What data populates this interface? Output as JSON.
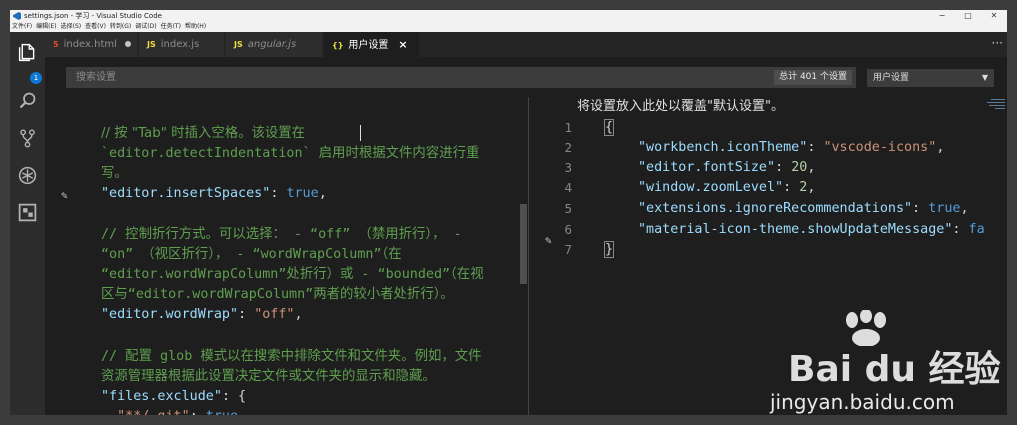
{
  "window": {
    "title": "settings.json - 学习 - Visual Studio Code",
    "controls": {
      "minimize": "−",
      "maximize": "□",
      "close": "✕"
    }
  },
  "menubar": [
    "文件(F)",
    "编辑(E)",
    "选择(S)",
    "查看(V)",
    "转到(G)",
    "调试(D)",
    "任务(T)",
    "帮助(H)"
  ],
  "activity_bar": {
    "icons": [
      "files-icon",
      "search-icon",
      "source-control-icon",
      "debug-icon",
      "extensions-icon"
    ],
    "badge": "1"
  },
  "tabs": [
    {
      "label": "index.html",
      "icon": "HTML5",
      "modified": true,
      "active": false
    },
    {
      "label": "index.js",
      "icon": "JS",
      "active": false
    },
    {
      "label": "angular.js",
      "icon": "JS",
      "active": false,
      "italic": true
    },
    {
      "label": "用户设置",
      "icon": "{}",
      "active": true,
      "close": "×"
    }
  ],
  "search": {
    "placeholder": "搜索设置",
    "count": "总计 401 个设置",
    "scope": "用户设置"
  },
  "left_editor": {
    "lines": [
      "// 按 \"Tab\" 时插入空格。该设置在",
      "`editor.detectIndentation` 启用时根据文件内容进行重",
      "写。",
      "\"editor.insertSpaces\": true,",
      "",
      "// 控制折行方式。可以选择： - “off” （禁用折行）， -",
      "“on” （视区折行）， - “wordWrapColumn”（在",
      "“editor.wordWrapColumn”处折行）或 - “bounded”（在视",
      "区与“editor.wordWrapColumn”两者的较小者处折行）。",
      "\"editor.wordWrap\": \"off\",",
      "",
      "// 配置 glob 模式以在搜索中排除文件和文件夹。例如，文件",
      "资源管理器根据此设置决定文件或文件夹的显示和隐藏。",
      "\"files.exclude\": {",
      "  \"**/.git\": true,"
    ]
  },
  "right_editor": {
    "header": "将设置放入此处以覆盖\"默认设置\"。",
    "line_numbers": [
      "1",
      "2",
      "3",
      "4",
      "5",
      "6",
      "7"
    ],
    "settings": [
      {
        "key": "\"workbench.iconTheme\"",
        "value": "\"vscode-icons\""
      },
      {
        "key": "\"editor.fontSize\"",
        "value": "20"
      },
      {
        "key": "\"window.zoomLevel\"",
        "value": "2"
      },
      {
        "key": "\"extensions.ignoreRecommendations\"",
        "value": "true"
      },
      {
        "key": "\"material-icon-theme.showUpdateMessage\"",
        "value": "fa"
      }
    ],
    "open_brace": "{",
    "close_brace": "}"
  },
  "watermark": {
    "brand": "Bai du 经验",
    "url": "jingyan.baidu.com"
  }
}
